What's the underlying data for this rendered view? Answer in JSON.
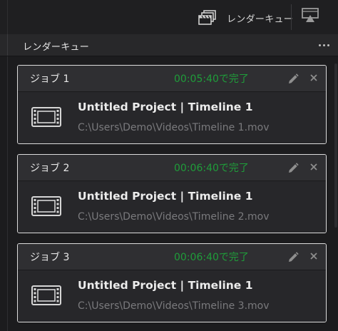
{
  "toolbar": {
    "queue_label": "レンダーキュー",
    "queue_icon": "render-queue-icon",
    "cast_icon": "display-output-icon"
  },
  "panel": {
    "title": "レンダーキュー",
    "more_icon": "more-options-icon"
  },
  "colors": {
    "status_complete": "#1f9d3a",
    "card_border": "#dcdcdc",
    "path_text": "#7a7a7d"
  },
  "jobs": [
    {
      "name": "ジョブ 1",
      "status": "00:05:40で完了",
      "title": "Untitled Project | Timeline 1",
      "path": "C:\\Users\\Demo\\Videos\\Timeline 1.mov"
    },
    {
      "name": "ジョブ 2",
      "status": "00:06:40で完了",
      "title": "Untitled Project | Timeline 1",
      "path": "C:\\Users\\Demo\\Videos\\Timeline 2.mov"
    },
    {
      "name": "ジョブ 3",
      "status": "00:06:40で完了",
      "title": "Untitled Project | Timeline 1",
      "path": "C:\\Users\\Demo\\Videos\\Timeline 3.mov"
    }
  ]
}
